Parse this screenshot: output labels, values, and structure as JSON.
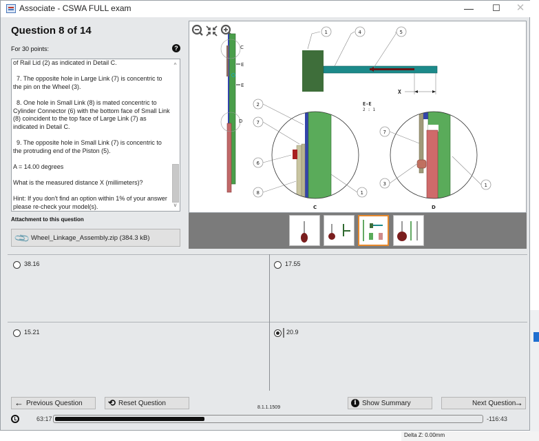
{
  "window": {
    "title": "Associate - CSWA FULL exam",
    "controls": {
      "minimize": "—",
      "maximize": "☐",
      "close": "✕"
    }
  },
  "question": {
    "title": "Question 8 of 14",
    "points": "For 30 points:",
    "help_icon": "?",
    "paragraphs": [
      "of Rail Lid (2) as indicated in Detail C.",
      "7. The opposite hole in Large Link (7) is concentric to the pin on the Wheel (3).",
      "8. One hole in Small Link (8) is mated concentric to Cylinder Connector (6) with the bottom face of Small Link (8) coincident to the top face of Large Link (7) as indicated in Detail C.",
      "9. The opposite hole in Small Link (7) is concentric to the protruding end of the Piston (5).",
      "A = 14.00 degrees",
      "What is the measured distance X (millimeters)?",
      "Hint: If you don't find an option within 1% of your answer please re-check your model(s)."
    ],
    "scroll_up": "^",
    "scroll_down": "v"
  },
  "attachment": {
    "label": "Attachment to this question",
    "icon": "paperclip-icon",
    "file": "Wheel_Linkage_Assembly.zip (384.3 kB)"
  },
  "viewer": {
    "zoom_out_icon": "zoom-out-icon",
    "fit_icon": "fit-icon",
    "zoom_in_icon": "zoom-in-icon",
    "labels": {
      "balloons": [
        "1",
        "4",
        "5",
        "2",
        "7",
        "6",
        "8",
        "1",
        "7",
        "3",
        "1"
      ],
      "section_mark": "E",
      "detail_c_mark": "C",
      "detail_d_mark": "D",
      "section_title": "E-E",
      "section_scale": "2 : 1",
      "dimension": "X",
      "detail_c_caption": "C",
      "detail_d_caption": "D"
    },
    "thumbnails": [
      {
        "name": "view-1",
        "selected": false
      },
      {
        "name": "view-2",
        "selected": false
      },
      {
        "name": "view-3",
        "selected": true
      },
      {
        "name": "view-4",
        "selected": false
      }
    ]
  },
  "answers": [
    {
      "value": "38.16",
      "selected": false
    },
    {
      "value": "17.55",
      "selected": false
    },
    {
      "value": "15.21",
      "selected": false
    },
    {
      "value": "20.9",
      "selected": true
    }
  ],
  "footer": {
    "previous": "Previous Question",
    "reset": "Reset Question",
    "summary": "Show Summary",
    "next": "Next Question",
    "version": "8.1.1.1509",
    "elapsed": "63:17",
    "remaining": "-116:43",
    "progress_percent": 35,
    "icons": {
      "prev": "←",
      "reset": "⟲",
      "summary": "i",
      "next": "→"
    }
  },
  "background": {
    "status_text": "Delta Z: 0.00mm"
  }
}
